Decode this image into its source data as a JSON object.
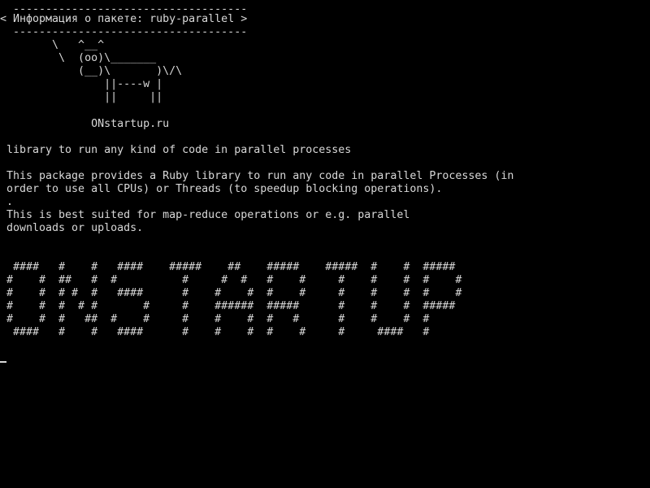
{
  "terminal": {
    "colors": {
      "background": "#000000",
      "foreground": "#d8d8d8"
    },
    "cowsay": {
      "top_border": " ------------------------------------",
      "title": "< Информация о пакете: ruby-parallel >",
      "bottom_border": " ------------------------------------",
      "cow": [
        "       \\   ^__^",
        "        \\  (oo)\\_______",
        "           (__)\\       )\\/\\",
        "               ||----w |",
        "               ||     ||"
      ],
      "site": "             ONstartup.ru"
    },
    "summary": "library to run any kind of code in parallel processes",
    "description": [
      "This package provides a Ruby library to run any code in parallel Processes (in",
      "order to use all CPUs) or Threads (to speedup blocking operations).",
      ".",
      "This is best suited for map-reduce operations or e.g. parallel",
      "downloads or uploads."
    ],
    "banner": [
      " ####   #    #   ####    #####    ##    #####    #####  #    #  #####",
      "#    #  ##   #  #          #     #  #   #    #     #    #    #  #    #",
      "#    #  # #  #   ####      #    #    #  #    #     #    #    #  #    #",
      "#    #  #  # #       #     #    ######  #####      #    #    #  #####",
      "#    #  #   ##  #    #     #    #    #  #   #      #    #    #  #",
      " ####   #    #   ####      #    #    #  #    #     #     ####   #"
    ]
  }
}
